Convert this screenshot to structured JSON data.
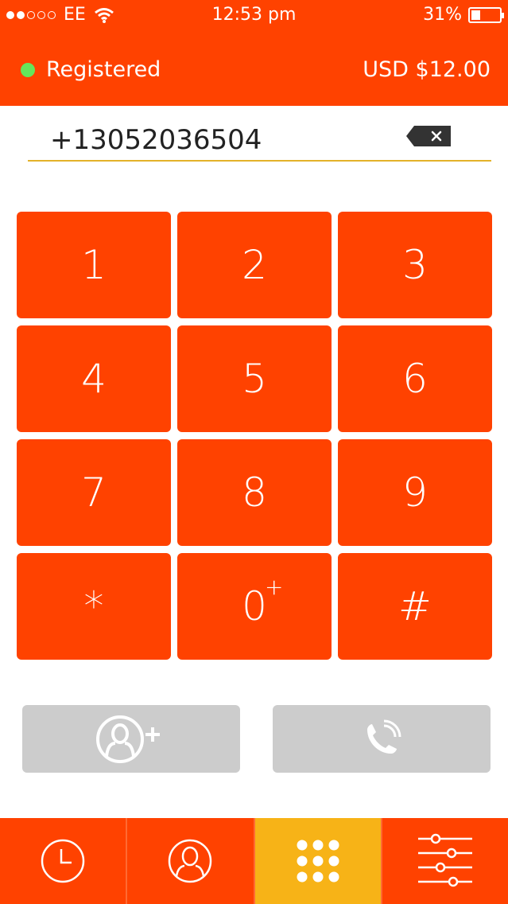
{
  "status_bar": {
    "carrier": "EE",
    "time": "12:53 pm",
    "battery": "31%",
    "battery_level": 0.31,
    "signal_bars": 2,
    "signal_total": 5
  },
  "header": {
    "status": "Registered",
    "status_color": "#65e65a",
    "balance": "USD $12.00"
  },
  "dialer": {
    "number": "+13052036504"
  },
  "keypad": {
    "keys": [
      {
        "label": "1"
      },
      {
        "label": "2"
      },
      {
        "label": "3"
      },
      {
        "label": "4"
      },
      {
        "label": "5"
      },
      {
        "label": "6"
      },
      {
        "label": "7"
      },
      {
        "label": "8"
      },
      {
        "label": "9"
      },
      {
        "label": "*"
      },
      {
        "label": "0",
        "sup": "+"
      },
      {
        "label": "#"
      }
    ]
  },
  "actions": {
    "add_contact_icon": "add-contact-icon",
    "call_icon": "phone-call-icon"
  },
  "tabs": [
    {
      "icon": "clock-icon",
      "active": false
    },
    {
      "icon": "contacts-icon",
      "active": false
    },
    {
      "icon": "keypad-icon",
      "active": true
    },
    {
      "icon": "settings-sliders-icon",
      "active": false
    }
  ],
  "colors": {
    "accent": "#ff4200",
    "active_tab": "#f7b317",
    "disabled_button": "#cccccc",
    "underline": "#e3b22a"
  }
}
